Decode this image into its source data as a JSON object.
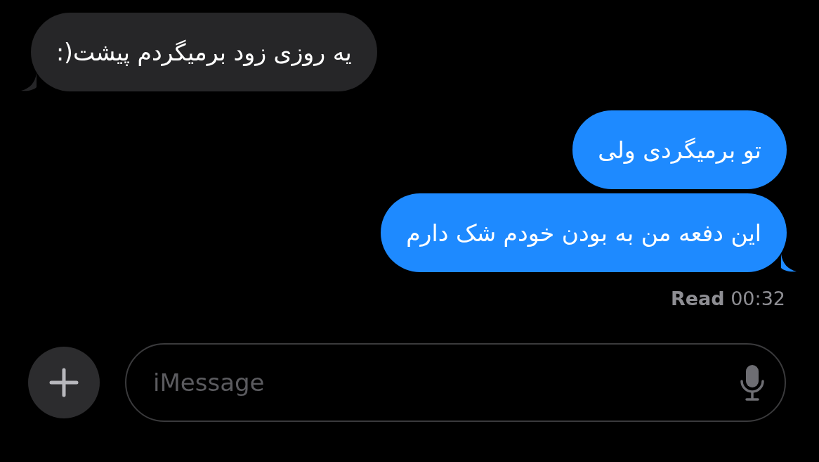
{
  "messages": [
    {
      "text": "یه روزی زود برمیگردم پیشت(:",
      "outgoing": false,
      "tail": true
    },
    {
      "text": "تو برمیگردی ولی",
      "outgoing": true,
      "tail": false
    },
    {
      "text": "این دفعه من به بودن خودم شک دارم",
      "outgoing": true,
      "tail": true
    }
  ],
  "receipt": "**Read** 00:32",
  "composer": {
    "placeholder": "iMessage"
  }
}
